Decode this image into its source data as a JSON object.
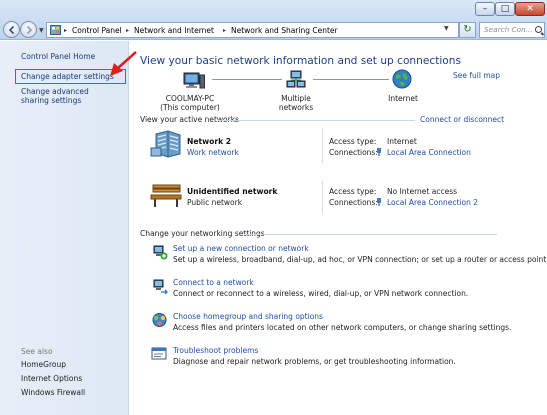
{
  "window": {
    "controls": [
      "minimize",
      "maximize",
      "close"
    ],
    "minimize_glyph": "–",
    "maximize_glyph": "□",
    "close_glyph": "✕"
  },
  "address_bar": {
    "breadcrumbs": [
      "Control Panel",
      "Network and Internet",
      "Network and Sharing Center"
    ],
    "search_placeholder": "Search Con..."
  },
  "left_pane": {
    "home": "Control Panel Home",
    "links": [
      "Change adapter settings",
      "Change advanced sharing settings"
    ],
    "see_also_title": "See also",
    "see_also": [
      "HomeGroup",
      "Internet Options",
      "Windows Firewall"
    ]
  },
  "main": {
    "heading": "View your basic network information and set up connections",
    "see_full_map": "See full map",
    "map_nodes": [
      {
        "label": "COOLMAY-PC",
        "sublabel": "(This computer)"
      },
      {
        "label": "Multiple networks",
        "sublabel": ""
      },
      {
        "label": "Internet",
        "sublabel": ""
      }
    ],
    "active_networks_title": "View your active networks",
    "connect_disconnect": "Connect or disconnect",
    "networks": [
      {
        "name": "Network  2",
        "type": "Work network",
        "type_is_link": true,
        "access_label": "Access type:",
        "access_value": "Internet",
        "connections_label": "Connections:",
        "connection": "Local Area Connection"
      },
      {
        "name": "Unidentified network",
        "type": "Public network",
        "type_is_link": false,
        "access_label": "Access type:",
        "access_value": "No Internet access",
        "connections_label": "Connections:",
        "connection": "Local Area Connection 2"
      }
    ],
    "change_settings_title": "Change your networking settings",
    "tasks": [
      {
        "link": "Set up a new connection or network",
        "desc": "Set up a wireless, broadband, dial-up, ad hoc, or VPN connection; or set up a router or access point."
      },
      {
        "link": "Connect to a network",
        "desc": "Connect or reconnect to a wireless, wired, dial-up, or VPN network connection."
      },
      {
        "link": "Choose homegroup and sharing options",
        "desc": "Access files and printers located on other network computers, or change sharing settings."
      },
      {
        "link": "Troubleshoot problems",
        "desc": "Diagnose and repair network problems, or get troubleshooting information."
      }
    ]
  },
  "colors": {
    "link": "#1f4ea6",
    "heading": "#1f3f84",
    "highlight": "#d21fd6",
    "annotation_arrow": "#e02020"
  }
}
